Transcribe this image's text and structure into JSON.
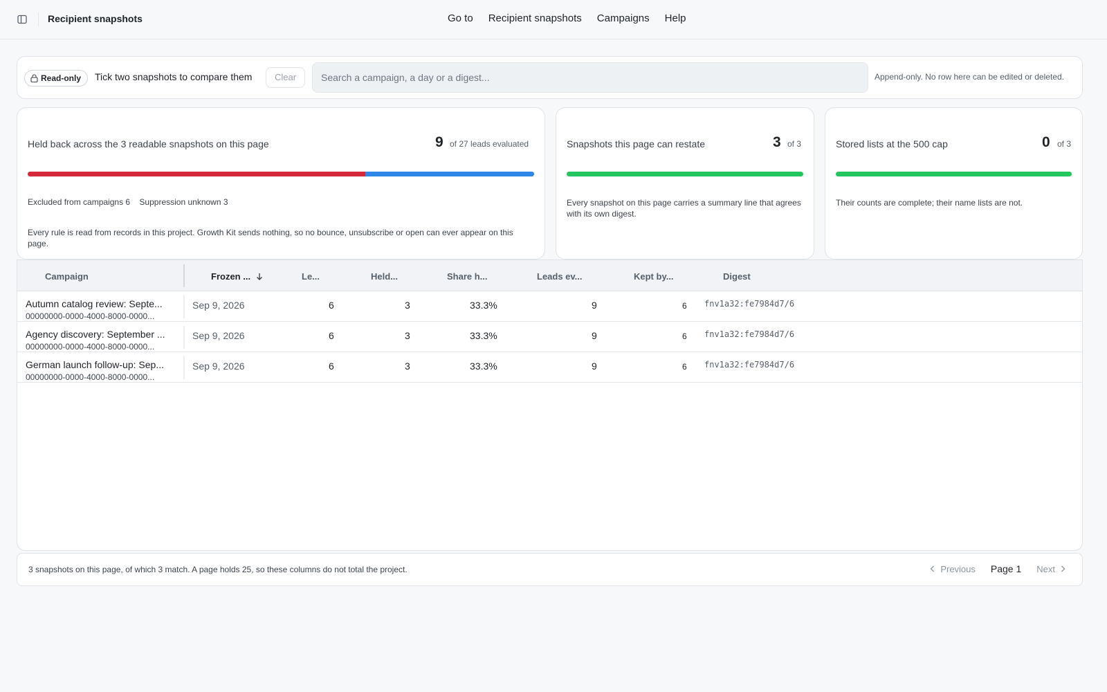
{
  "header": {
    "title": "Recipient snapshots",
    "nav": [
      "Go to",
      "Recipient snapshots",
      "Campaigns",
      "Help"
    ]
  },
  "toolbar": {
    "badge": "Read-only",
    "hint": "Tick two snapshots to compare them",
    "clear": "Clear",
    "search_placeholder": "Search a campaign, a day or a digest...",
    "note": "Append-only. No row here can be edited or deleted."
  },
  "cards": {
    "held": {
      "title": "Held back across the 3 readable snapshots on this page",
      "value": "9",
      "of": "of 27 leads evaluated",
      "excluded_label": "Excluded from campaigns 6",
      "unknown_label": "Suppression unknown 3",
      "excluded_share": 0.667,
      "unknown_share": 0.333,
      "desc": "Every rule is read from records in this project. Growth Kit sends nothing, so no bounce, unsubscribe or open can ever appear on this page."
    },
    "restate": {
      "title": "Snapshots this page can restate",
      "value": "3",
      "of": "of 3",
      "fill": 1.0,
      "desc": "Every snapshot on this page carries a summary line that agrees with its own digest."
    },
    "cap": {
      "title": "Stored lists at the 500 cap",
      "value": "0",
      "of": "of 3",
      "fill": 1.0,
      "desc": "Their counts are complete; their name lists are not."
    }
  },
  "colors": {
    "red": "#d62839",
    "blue": "#2f86e6",
    "green": "#22c55e"
  },
  "table": {
    "headers": [
      "Campaign",
      "Frozen ...",
      "Le...",
      "Held...",
      "Share h...",
      "Leads ev...",
      "Kept by...",
      "Digest"
    ],
    "rows": [
      {
        "campaign": "Autumn catalog review: Septe...",
        "id": "00000000-0000-4000-8000-0000...",
        "frozen": "Sep 9, 2026",
        "leads": "6",
        "held": "3",
        "share": "33.3%",
        "evaluated": "9",
        "kept": "6",
        "digest": "fnv1a32:fe7984d7/6"
      },
      {
        "campaign": "Agency discovery: September ...",
        "id": "00000000-0000-4000-8000-0000...",
        "frozen": "Sep 9, 2026",
        "leads": "6",
        "held": "3",
        "share": "33.3%",
        "evaluated": "9",
        "kept": "6",
        "digest": "fnv1a32:fe7984d7/6"
      },
      {
        "campaign": "German launch follow-up: Sep...",
        "id": "00000000-0000-4000-8000-0000...",
        "frozen": "Sep 9, 2026",
        "leads": "6",
        "held": "3",
        "share": "33.3%",
        "evaluated": "9",
        "kept": "6",
        "digest": "fnv1a32:fe7984d7/6"
      }
    ]
  },
  "footer": {
    "text": "3 snapshots on this page, of which 3 match. A page holds 25, so these columns do not total the project.",
    "previous": "Previous",
    "page": "Page 1",
    "next": "Next"
  }
}
